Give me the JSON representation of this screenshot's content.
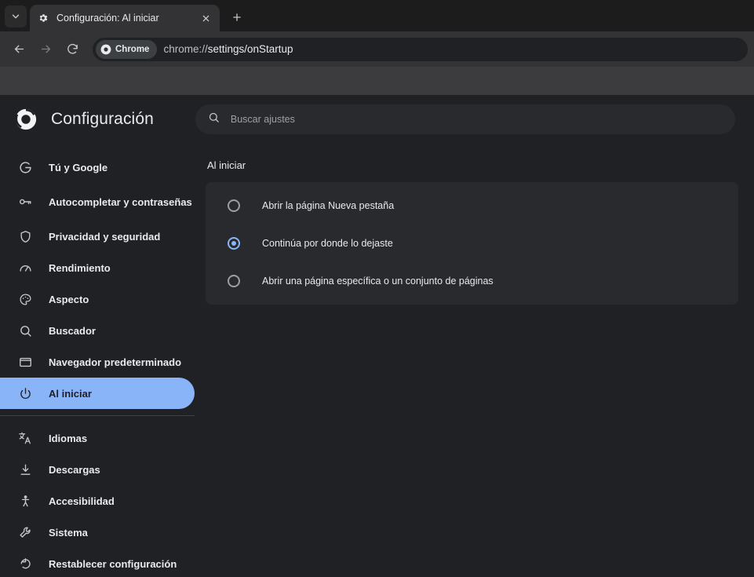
{
  "browser": {
    "tab": {
      "title": "Configuración: Al iniciar",
      "favicon_icon": "gear-icon",
      "close_icon": "close-icon"
    },
    "tab_search_icon": "chevron-down-icon",
    "new_tab_icon": "plus-icon",
    "toolbar": {
      "back_icon": "arrow-left-icon",
      "forward_icon": "arrow-right-icon",
      "reload_icon": "reload-icon",
      "chip_label": "Chrome",
      "chip_icon": "chrome-logo-icon",
      "url_scheme": "chrome://",
      "url_path": "settings/onStartup"
    }
  },
  "settings": {
    "logo_icon": "chrome-logo-icon",
    "title": "Configuración",
    "search": {
      "icon": "search-icon",
      "placeholder": "Buscar ajustes"
    }
  },
  "sidebar": {
    "items": [
      {
        "label": "Tú y Google",
        "icon": "google-g-icon",
        "selected": false
      },
      {
        "label": "Autocompletar y contraseñas",
        "icon": "key-icon",
        "selected": false
      },
      {
        "label": "Privacidad y seguridad",
        "icon": "shield-icon",
        "selected": false
      },
      {
        "label": "Rendimiento",
        "icon": "speedometer-icon",
        "selected": false
      },
      {
        "label": "Aspecto",
        "icon": "palette-icon",
        "selected": false
      },
      {
        "label": "Buscador",
        "icon": "search-icon",
        "selected": false
      },
      {
        "label": "Navegador predeterminado",
        "icon": "browser-window-icon",
        "selected": false
      },
      {
        "label": "Al iniciar",
        "icon": "power-icon",
        "selected": true
      },
      {
        "label": "Idiomas",
        "icon": "translate-icon",
        "selected": false
      },
      {
        "label": "Descargas",
        "icon": "download-icon",
        "selected": false
      },
      {
        "label": "Accesibilidad",
        "icon": "accessibility-icon",
        "selected": false
      },
      {
        "label": "Sistema",
        "icon": "wrench-icon",
        "selected": false
      },
      {
        "label": "Restablecer configuración",
        "icon": "restore-icon",
        "selected": false
      }
    ]
  },
  "main": {
    "section_title": "Al iniciar",
    "options": [
      {
        "label": "Abrir la página Nueva pestaña",
        "checked": false
      },
      {
        "label": "Continúa por donde lo dejaste",
        "checked": true
      },
      {
        "label": "Abrir una página específica o un conjunto de páginas",
        "checked": false
      }
    ]
  },
  "colors": {
    "accent": "#8ab4f8",
    "page_bg": "#202124",
    "card_bg": "#292a2d",
    "toolbar_bg": "#333336",
    "text": "#e8eaed"
  }
}
